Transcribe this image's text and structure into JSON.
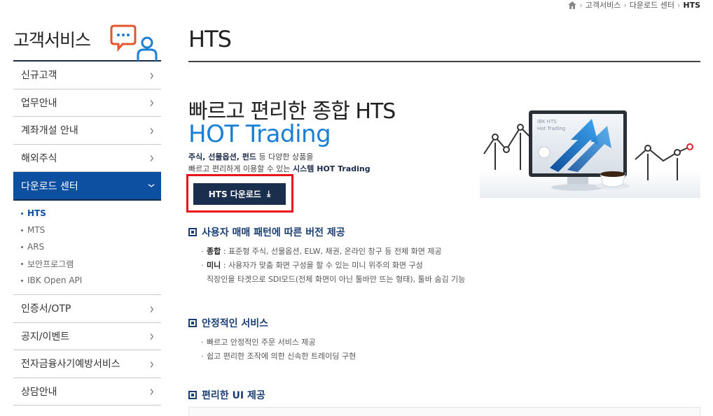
{
  "breadcrumb": {
    "items": [
      "고객서비스",
      "다운로드 센터",
      "HTS"
    ]
  },
  "sidebar": {
    "title": "고객서비스",
    "items": [
      {
        "label": "신규고객"
      },
      {
        "label": "업무안내"
      },
      {
        "label": "계좌개설 안내"
      },
      {
        "label": "해외주식"
      },
      {
        "label": "다운로드 센터"
      }
    ],
    "submenu": [
      "HTS",
      "MTS",
      "ARS",
      "보안프로그램",
      "IBK Open API"
    ],
    "items_after": [
      {
        "label": "인증서/OTP"
      },
      {
        "label": "공지/이벤트"
      },
      {
        "label": "전자금융사기예방서비스"
      },
      {
        "label": "상담안내"
      }
    ]
  },
  "main": {
    "page_title": "HTS",
    "headline": "빠르고 편리한 종합 HTS",
    "product_name": "HOT Trading",
    "desc_line1_bold": "주식, 선물옵션, 펀드",
    "desc_line1_rest": " 등 다양한 상품을",
    "desc_line2_rest": "빠르고 편리하게 이용할 수 있는 ",
    "desc_line2_bold": "시스템 HOT Trading",
    "download_label": "HTS 다운로드",
    "monitor_text1": "IBK HTS",
    "monitor_text2": "Hot Trading"
  },
  "sections": [
    {
      "title": "사용자 매매 패턴에 따른 버전 제공",
      "bullets": [
        {
          "bold": "종합",
          "text": " : 표준형 주식, 선물옵션, ELW, 채권, 온라인 창구 등 전체 화면 제공"
        },
        {
          "bold": "미니",
          "text": " : 사용자가 맞춤 화면 구성을 할 수 있는 미니 위주의 화면 구성"
        }
      ],
      "continuation": "직장인을 타겟으로 SDI모드(전체 화면이 아닌 툴바만 뜨는 형태), 툴바 숨김 기능"
    },
    {
      "title": "안정적인 서비스",
      "bullets": [
        {
          "bold": "",
          "text": "빠르고 안정적인 주문 서비스 제공"
        },
        {
          "bold": "",
          "text": "쉽고 편리한 조작에 의한 신속한 트레이딩 구현"
        }
      ]
    },
    {
      "title": "편리한 UI 제공"
    }
  ],
  "colors": {
    "primary_nav": "#0d4fa0",
    "accent_blue": "#1a7fd4",
    "highlight_red": "#e8131b",
    "button_dark": "#1a2f4e"
  }
}
